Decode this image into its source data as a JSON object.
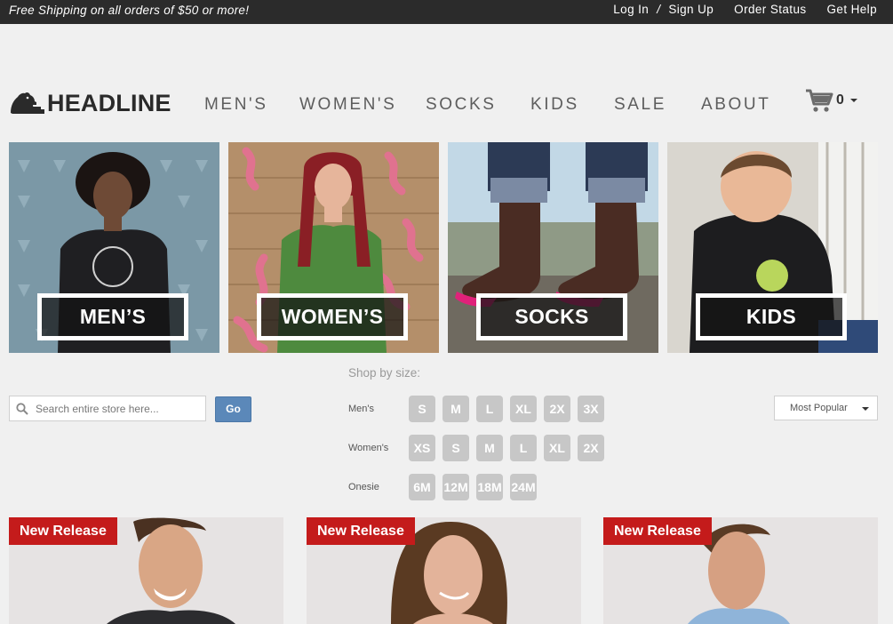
{
  "topbar": {
    "promo": "Free Shipping on all orders of $50 or more!",
    "login": "Log In",
    "separator": "/",
    "signup": "Sign Up",
    "order_status": "Order Status",
    "help": "Get Help"
  },
  "logo": {
    "text": "HEADLINE",
    "icon": "bear-icon"
  },
  "nav": [
    "MEN'S",
    "WOMEN'S",
    "SOCKS",
    "KIDS",
    "SALE",
    "ABOUT"
  ],
  "cart": {
    "count": "0",
    "icon": "cart-icon"
  },
  "categories": [
    {
      "label": "MEN’S"
    },
    {
      "label": "WOMEN’S"
    },
    {
      "label": "SOCKS"
    },
    {
      "label": "KIDS"
    }
  ],
  "search": {
    "placeholder": "Search entire store here...",
    "button": "Go",
    "icon": "search-icon"
  },
  "shop_by_size": {
    "title": "Shop by size:",
    "rows": [
      {
        "label": "Men's",
        "sizes": [
          "S",
          "M",
          "L",
          "XL",
          "2X",
          "3X"
        ]
      },
      {
        "label": "Women's",
        "sizes": [
          "XS",
          "S",
          "M",
          "L",
          "XL",
          "2X"
        ]
      },
      {
        "label": "Onesie",
        "sizes": [
          "6M",
          "12M",
          "18M",
          "24M"
        ]
      }
    ]
  },
  "sort": {
    "selected": "Most Popular"
  },
  "products": [
    {
      "badge": "New Release"
    },
    {
      "badge": "New Release"
    },
    {
      "badge": "New Release"
    }
  ],
  "colors": {
    "topbar": "#2b2b2b",
    "badge": "#c41b1b",
    "go_button": "#5b88b9",
    "size_chip": "#c7c7c7"
  }
}
